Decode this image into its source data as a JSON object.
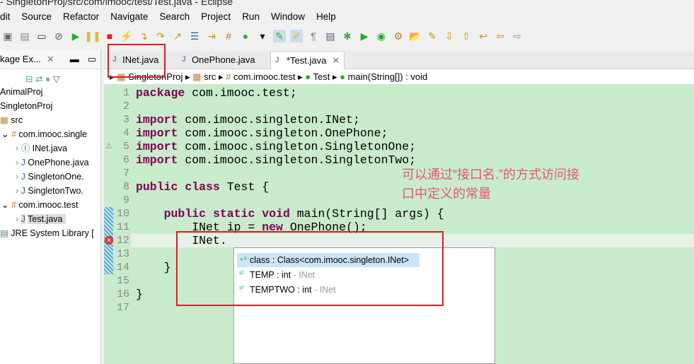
{
  "window_title": "- SingletonProj/src/com/imooc/test/Test.java - Eclipse",
  "menu": [
    "dit",
    "Source",
    "Refactor",
    "Navigate",
    "Search",
    "Project",
    "Run",
    "Window",
    "Help"
  ],
  "package_explorer": {
    "title": "kage Ex...",
    "items": [
      {
        "label": "AnimalProj"
      },
      {
        "label": "SingletonProj"
      },
      {
        "label": "src"
      },
      {
        "label": "com.imooc.single"
      },
      {
        "label": "INet.java"
      },
      {
        "label": "OnePhone.java"
      },
      {
        "label": "SingletonOne."
      },
      {
        "label": "SingletonTwo."
      },
      {
        "label": "com.imooc.test"
      },
      {
        "label": "Test.java"
      },
      {
        "label": "JRE System Library ["
      }
    ]
  },
  "tabs": [
    {
      "label": "INet.java"
    },
    {
      "label": "OnePhone.java"
    },
    {
      "label": "*Test.java"
    }
  ],
  "breadcrumb": [
    "SingletonProj",
    "src",
    "com.imooc.test",
    "Test",
    "main(String[]) : void"
  ],
  "code_lines": [
    {
      "n": "1",
      "text": "package com.imooc.test;"
    },
    {
      "n": "2",
      "text": ""
    },
    {
      "n": "3",
      "text": "import com.imooc.singleton.INet;"
    },
    {
      "n": "4",
      "text": "import com.imooc.singleton.OnePhone;"
    },
    {
      "n": "5",
      "text": "import com.imooc.singleton.SingletonOne;"
    },
    {
      "n": "6",
      "text": "import com.imooc.singleton.SingletonTwo;"
    },
    {
      "n": "7",
      "text": ""
    },
    {
      "n": "8",
      "text": "public class Test {"
    },
    {
      "n": "9",
      "text": ""
    },
    {
      "n": "10",
      "text": "    public static void main(String[] args) {"
    },
    {
      "n": "11",
      "text": "        INet ip = new OnePhone();"
    },
    {
      "n": "12",
      "text": "        INet."
    },
    {
      "n": "13",
      "text": ""
    },
    {
      "n": "14",
      "text": "    }"
    },
    {
      "n": "15",
      "text": ""
    },
    {
      "n": "16",
      "text": "}"
    },
    {
      "n": "17",
      "text": ""
    }
  ],
  "annotation": [
    "可以通过“接口名.”的方式访问接",
    "口中定义的常量"
  ],
  "autocomplete": [
    {
      "name": "class : Class<com.imooc.singleton.INet>",
      "owner": ""
    },
    {
      "name": "TEMP : int",
      "owner": " - INet"
    },
    {
      "name": "TEMPTWO : int",
      "owner": " - INet"
    }
  ],
  "colors": {
    "editor_bg": "#c8ebcc",
    "keyword": "#7f0055",
    "highlight": "#d0202a"
  }
}
